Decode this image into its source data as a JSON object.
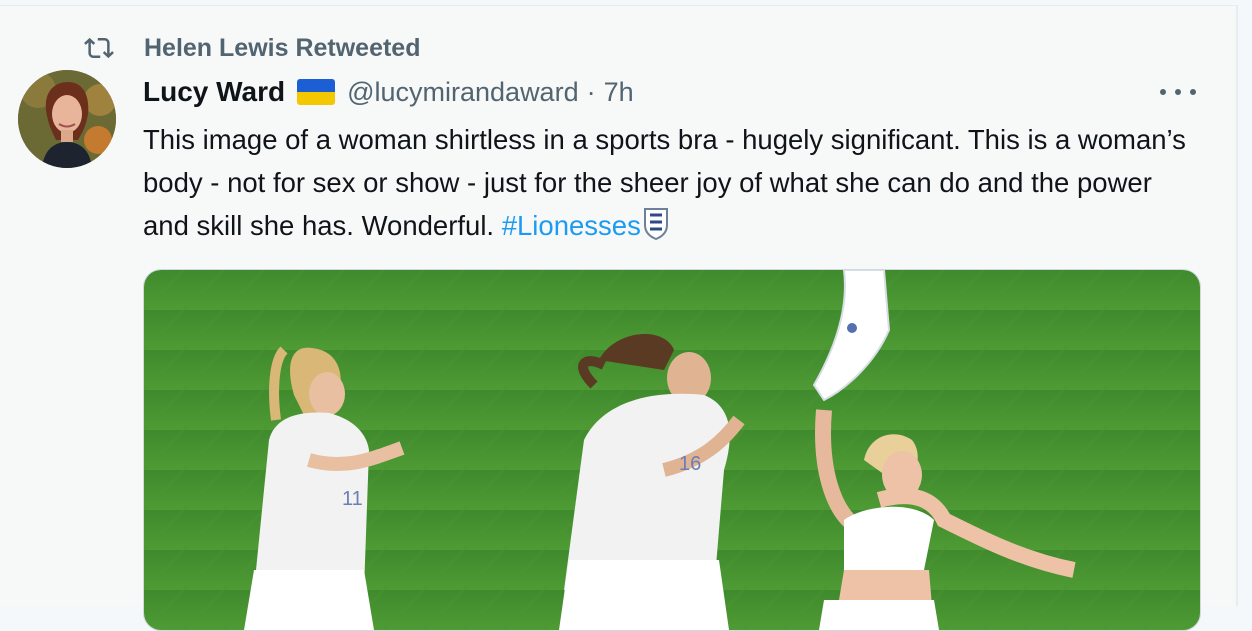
{
  "retweet": {
    "label": "Helen Lewis Retweeted",
    "icon": "retweet-icon"
  },
  "tweet": {
    "author_name": "Lucy Ward",
    "handle": "@lucymirandaward",
    "separator": "·",
    "time": "7h",
    "text_main": "This image of a woman shirtless in a sports bra - hugely  significant. This is a woman’s body - not for sex or show - just for the sheer joy  of what she can do and the power and skill she has. Wonderful. ",
    "hashtag": "#Lionesses",
    "flag_colors": {
      "top": "#1c5fd4",
      "bottom": "#f3c800"
    },
    "icons": [
      "ukraine-flag-icon",
      "england-shield-icon",
      "more-icon"
    ]
  },
  "media": {
    "jersey_numbers": [
      "11",
      "16"
    ]
  },
  "colors": {
    "background": "#f7f9f9",
    "text": "#0f1419",
    "secondary": "#536471",
    "link": "#1d9bf0"
  }
}
